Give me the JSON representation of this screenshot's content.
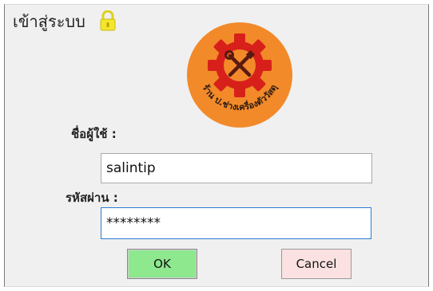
{
  "window": {
    "title": "เข้าสู่ระบบ"
  },
  "logo": {
    "text": "ร้าน ป.ช่างเครื่องตัววัสดุ",
    "colors": {
      "ring": "#f28a2a",
      "gear": "#d8201b",
      "tools": "#5a1a10"
    }
  },
  "form": {
    "username_label": "ชื่อผู้ใช้ :",
    "username_value": "salintip",
    "password_label": "รหัสผ่าน :",
    "password_value": "********"
  },
  "buttons": {
    "ok_label": "OK",
    "cancel_label": "Cancel"
  },
  "icons": {
    "title_icon": "padlock-icon"
  },
  "colors": {
    "ok_bg": "#8ee88e",
    "cancel_bg": "#fbe1e1",
    "focus_border": "#2a7bd4"
  }
}
